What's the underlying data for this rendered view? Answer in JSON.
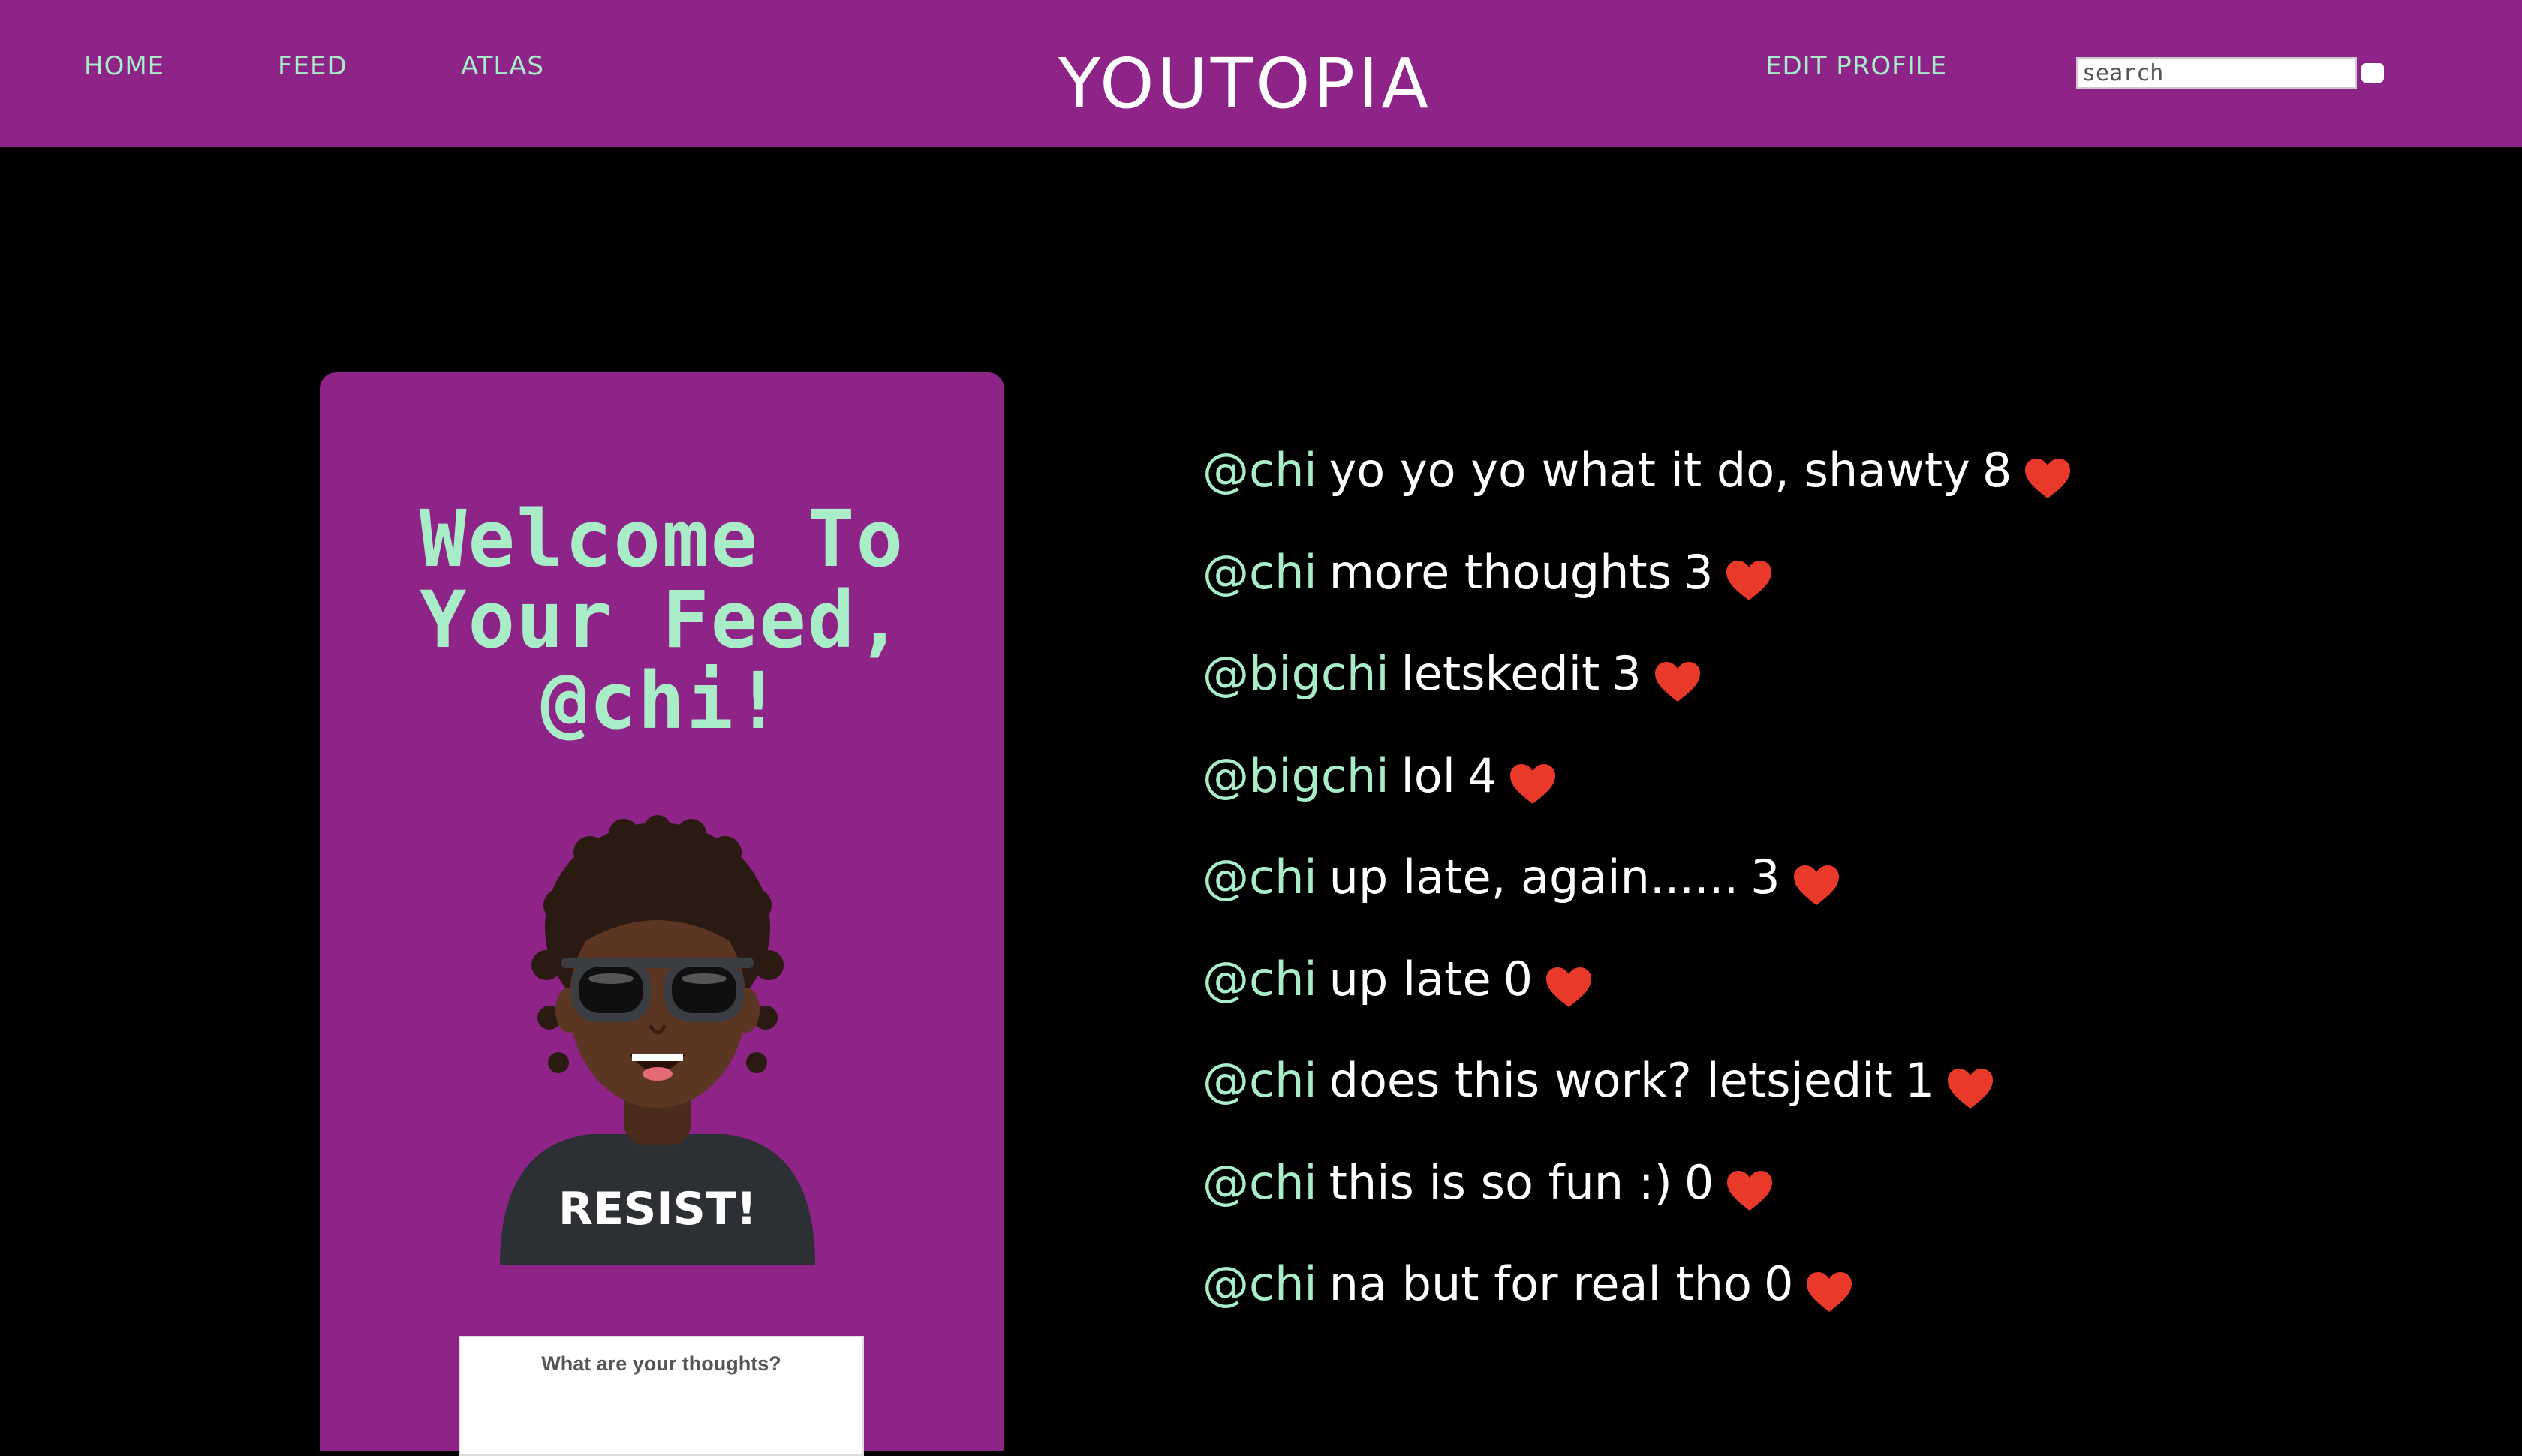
{
  "nav": {
    "home_label": "HOME",
    "feed_label": "FEED",
    "atlas_label": "ATLAS",
    "edit_profile_label": "EDIT PROFILE",
    "brand": "YOUTOPIA",
    "search_placeholder": "search"
  },
  "panel": {
    "welcome_line1": "Welcome To",
    "welcome_line2": "Your Feed,",
    "welcome_line3": "@chi!",
    "avatar_shirt_text": "RESIST!",
    "thoughts_placeholder": "What are your thoughts?"
  },
  "feed": {
    "posts": [
      {
        "handle": "@chi",
        "text": "yo yo yo what it do, shawty",
        "likes": "8"
      },
      {
        "handle": "@chi",
        "text": "more thoughts",
        "likes": "3"
      },
      {
        "handle": "@bigchi",
        "text": "letskedit",
        "likes": "3"
      },
      {
        "handle": "@bigchi",
        "text": "lol",
        "likes": "4"
      },
      {
        "handle": "@chi",
        "text": "up late, again......",
        "likes": "3"
      },
      {
        "handle": "@chi",
        "text": "up late",
        "likes": "0"
      },
      {
        "handle": "@chi",
        "text": "does this work? letsjedit",
        "likes": "1"
      },
      {
        "handle": "@chi",
        "text": "this is so fun :)",
        "likes": "0"
      },
      {
        "handle": "@chi",
        "text": "na but for real tho",
        "likes": "0"
      }
    ]
  },
  "colors": {
    "accent_purple": "#8e2388",
    "mint": "#a8ecc8",
    "heart_red": "#e8392a",
    "background": "#000000"
  },
  "icons": {
    "like": "heart-icon",
    "search": "search-submit-button"
  }
}
